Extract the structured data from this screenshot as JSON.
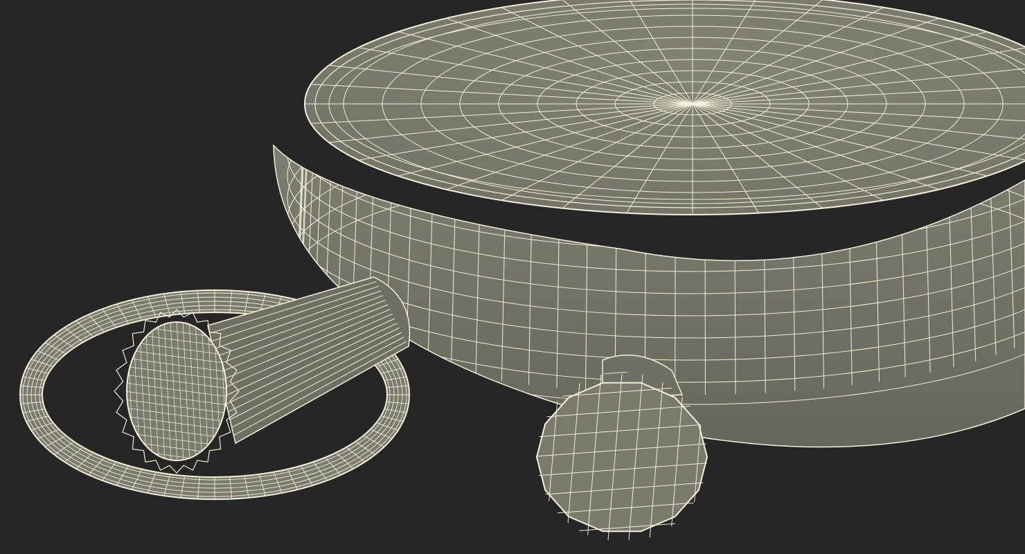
{
  "viewport": {
    "background": "#262626",
    "surface_color": "#7a7b6d",
    "surface_dark": "#6d6e61",
    "wire_color": "#f4f0da"
  },
  "objects": [
    "stopwatch-body",
    "crown-stem",
    "bow-ring",
    "side-pusher"
  ]
}
